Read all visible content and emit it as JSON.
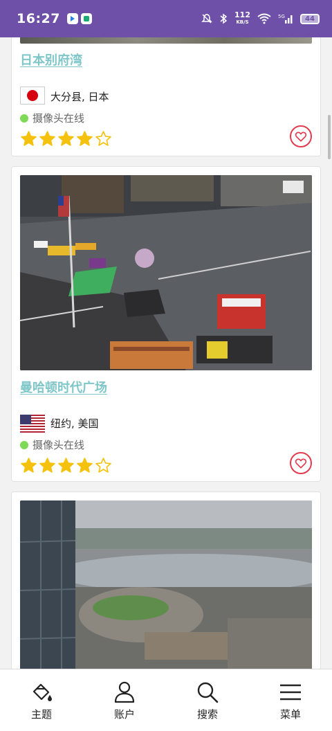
{
  "status_bar": {
    "time": "16:27",
    "net_speed_value": "112",
    "net_speed_unit": "KB/S",
    "battery": "44",
    "signal": "5G"
  },
  "cards": [
    {
      "title": "日本别府湾",
      "location": "大分县, 日本",
      "country_flag": "japan-flag",
      "status": "摄像头在线",
      "rating": 4,
      "rating_max": 5
    },
    {
      "title": "曼哈顿时代广场",
      "location": "纽约, 美国",
      "country_flag": "usa-flag",
      "status": "摄像头在线",
      "rating": 4,
      "rating_max": 5
    },
    {
      "title": "",
      "image": "stadium-river-city-view"
    }
  ],
  "bottom_nav": [
    {
      "label": "主题",
      "icon": "paint-bucket-icon"
    },
    {
      "label": "账户",
      "icon": "user-icon"
    },
    {
      "label": "搜索",
      "icon": "search-icon"
    },
    {
      "label": "菜单",
      "icon": "menu-icon"
    }
  ],
  "colors": {
    "status_bar": "#6e50a8",
    "title_link": "#7fc6c9",
    "online_dot": "#7ed957",
    "star": "#f4c20d",
    "heart": "#e5394f"
  }
}
